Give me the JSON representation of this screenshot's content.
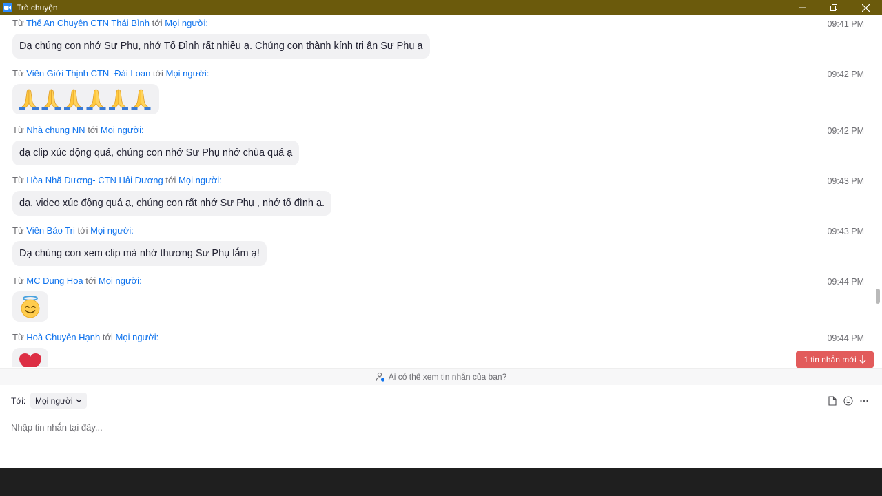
{
  "window": {
    "title": "Trò chuyện"
  },
  "labels": {
    "from": "Từ",
    "to_word": "tới"
  },
  "messages": [
    {
      "sender": "Thể An Chuyên CTN Thái Bình",
      "recipient": "Mọi người:",
      "time": "09:41 PM",
      "text": "Dạ chúng con nhớ Sư Phụ, nhớ Tổ Đình rất nhiều ạ. Chúng con thành kính tri ân Sư Phụ ạ"
    },
    {
      "sender": "Viên Giới Thịnh CTN -Đài Loan",
      "recipient": "Mọi người:",
      "time": "09:42 PM",
      "emoji": "folded-hands-icon x6"
    },
    {
      "sender": "Nhà chung NN",
      "recipient": "Mọi người:",
      "time": "09:42 PM",
      "text": "dạ clip xúc động quá, chúng con nhớ Sư Phụ nhớ chùa quá ạ"
    },
    {
      "sender": "Hòa Nhã Dương- CTN Hải Dương",
      "recipient": "Mọi người:",
      "time": "09:43 PM",
      "text": "dạ, video xúc động quá ạ, chúng con rất nhớ Sư Phụ , nhớ tổ đình ạ."
    },
    {
      "sender": "Viên Bảo Tri",
      "recipient": "Mọi người:",
      "time": "09:43 PM",
      "text": "Dạ chúng con xem clip mà nhớ thương Sư Phụ lắm ạ!"
    },
    {
      "sender": "MC Dung Hoa",
      "recipient": "Mọi người:",
      "time": "09:44 PM",
      "emoji": "smiling-face-with-halo-icon"
    },
    {
      "sender": "Hoà Chuyên Hạnh",
      "recipient": "Mọi người:",
      "time": "09:44 PM",
      "emoji": "red-heart-icon"
    }
  ],
  "new_message_button": "1 tin nhắn mới",
  "privacy_notice": "Ai có thể xem tin nhắn của bạn?",
  "composer": {
    "to_label": "Tới:",
    "recipient": "Mọi người",
    "placeholder": "Nhập tin nhắn tại đây..."
  },
  "colors": {
    "title_bar": "#6b5a0c",
    "link": "#0e72ed",
    "new_message": "#e25b5b",
    "bubble": "#f1f1f3"
  }
}
